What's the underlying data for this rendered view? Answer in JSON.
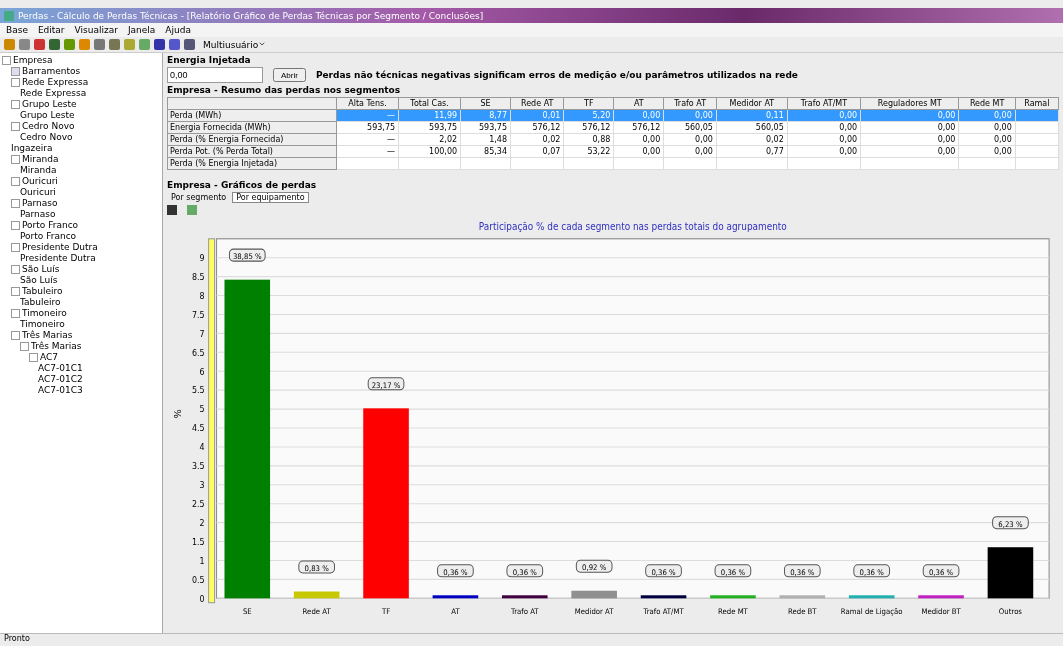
{
  "window": {
    "title": "Perdas - Cálculo de Perdas Técnicas - [Relatório Gráfico de Perdas Técnicas por Segmento / Conclusões]"
  },
  "menu": [
    "Base",
    "Editar",
    "Visualizar",
    "Janela",
    "Ajuda"
  ],
  "toolbar": {
    "dropdown": "Multiusuário"
  },
  "tree": [
    {
      "label": "Empresa",
      "expanded": true,
      "children": [
        {
          "label": "Barramentos",
          "expanded": false
        },
        {
          "label": "Rede Expressa",
          "expanded": true,
          "children": [
            {
              "label": "Rede Expressa"
            }
          ]
        },
        {
          "label": "Grupo Leste",
          "expanded": true,
          "children": [
            {
              "label": "Grupo Leste"
            }
          ]
        },
        {
          "label": "Cedro Novo",
          "expanded": true,
          "children": [
            {
              "label": "Cedro Novo"
            }
          ]
        },
        {
          "label": "Ingazeira"
        },
        {
          "label": "Miranda",
          "expanded": true,
          "children": [
            {
              "label": "Miranda"
            }
          ]
        },
        {
          "label": "Ouricuri",
          "expanded": true,
          "children": [
            {
              "label": "Ouricuri"
            }
          ]
        },
        {
          "label": "Parnaso",
          "expanded": true,
          "children": [
            {
              "label": "Parnaso"
            }
          ]
        },
        {
          "label": "Porto Franco",
          "expanded": true,
          "children": [
            {
              "label": "Porto Franco"
            }
          ]
        },
        {
          "label": "Presidente Dutra",
          "expanded": true,
          "children": [
            {
              "label": "Presidente Dutra"
            }
          ]
        },
        {
          "label": "São Luís",
          "expanded": true,
          "children": [
            {
              "label": "São Luís"
            }
          ]
        },
        {
          "label": "Tabuleiro",
          "expanded": true,
          "children": [
            {
              "label": "Tabuleiro"
            }
          ]
        },
        {
          "label": "Timoneiro",
          "expanded": true,
          "children": [
            {
              "label": "Timoneiro"
            }
          ]
        },
        {
          "label": "Três Marias",
          "expanded": true,
          "children": [
            {
              "label": "Três Marias",
              "expanded": true,
              "children": [
                {
                  "label": "AC7",
                  "expanded": true,
                  "children": [
                    {
                      "label": "AC7-01C1"
                    },
                    {
                      "label": "AC7-01C2"
                    },
                    {
                      "label": "AC7-01C3"
                    }
                  ]
                }
              ]
            }
          ]
        }
      ]
    }
  ],
  "energy": {
    "title": "Energia Injetada",
    "value": "0,00",
    "button": "Abrir",
    "note": "Perdas não técnicas negativas significam erros de medição e/ou parâmetros utilizados na rede"
  },
  "summary": {
    "title": "Empresa - Resumo das perdas nos segmentos",
    "columns": [
      "Alta Tens.",
      "Total Cas.",
      "SE",
      "Rede AT",
      "TF",
      "AT",
      "Trafo AT",
      "Medidor AT",
      "Trafo AT/MT",
      "Reguladores MT",
      "Rede MT",
      "Ramal"
    ],
    "rows": [
      {
        "label": "Perda (MWh)",
        "selected": true,
        "cells": [
          "—",
          "11,99",
          "8,77",
          "0,01",
          "5,20",
          "0,00",
          "0,00",
          "0,11",
          "0,00",
          "0,00",
          "0,00"
        ]
      },
      {
        "label": "Energia Fornecida (MWh)",
        "selected": false,
        "cells": [
          "593,75",
          "593,75",
          "593,75",
          "576,12",
          "576,12",
          "576,12",
          "560,05",
          "560,05",
          "0,00",
          "0,00",
          "0,00"
        ]
      },
      {
        "label": "Perda (% Energia Fornecida)",
        "selected": false,
        "cells": [
          "—",
          "2,02",
          "1,48",
          "0,02",
          "0,88",
          "0,00",
          "0,00",
          "0,02",
          "0,00",
          "0,00",
          "0,00"
        ]
      },
      {
        "label": "Perda Pot. (% Perda Total)",
        "selected": false,
        "cells": [
          "—",
          "100,00",
          "85,34",
          "0,07",
          "53,22",
          "0,00",
          "0,00",
          "0,77",
          "0,00",
          "0,00",
          "0,00"
        ]
      },
      {
        "label": "Perda (% Energia Injetada)",
        "selected": false,
        "cells": []
      }
    ]
  },
  "charts": {
    "title": "Empresa - Gráficos de perdas",
    "tabs": [
      {
        "label": "Por segmento",
        "selected": true
      },
      {
        "label": "Por equipamento",
        "selected": false
      }
    ],
    "chart_data": {
      "type": "bar",
      "title": "Participação % de cada segmento nas perdas totais do agrupamento",
      "ylabel": "%",
      "categories": [
        "SE",
        "Rede AT",
        "TF",
        "AT",
        "Trafo AT",
        "Medidor AT",
        "Trafo AT/MT",
        "Rede MT",
        "Rede BT",
        "Ramal de Ligação",
        "Medidor BT",
        "Outros"
      ],
      "grid": true,
      "series": [
        {
          "values": [
            8.42,
            0.18,
            5.02,
            0.08,
            0.08,
            0.2,
            0.08,
            0.08,
            0.08,
            0.08,
            0.08,
            1.35
          ]
        }
      ],
      "colors": [
        "#008000",
        "#c8c800",
        "#ff0000",
        "#0000c0",
        "#400040",
        "#909090",
        "#000040",
        "#20b020",
        "#b0b0b0",
        "#20b0b0",
        "#c020c0",
        "#000000"
      ],
      "value_labels": [
        "38,85 %",
        "0,83 %",
        "23,17 %",
        "0,36 %",
        "0,36 %",
        "0,92 %",
        "0,36 %",
        "0,36 %",
        "0,36 %",
        "0,36 %",
        "0,36 %",
        "6,23 %"
      ],
      "yticks": [
        0,
        0.5,
        1,
        1.5,
        2,
        2.5,
        3,
        3.5,
        4,
        4.5,
        5,
        5.5,
        6,
        6.5,
        7,
        7.5,
        8,
        8.5,
        9
      ],
      "ylim": [
        0,
        9.5
      ]
    }
  },
  "status_bar": "Pronto"
}
